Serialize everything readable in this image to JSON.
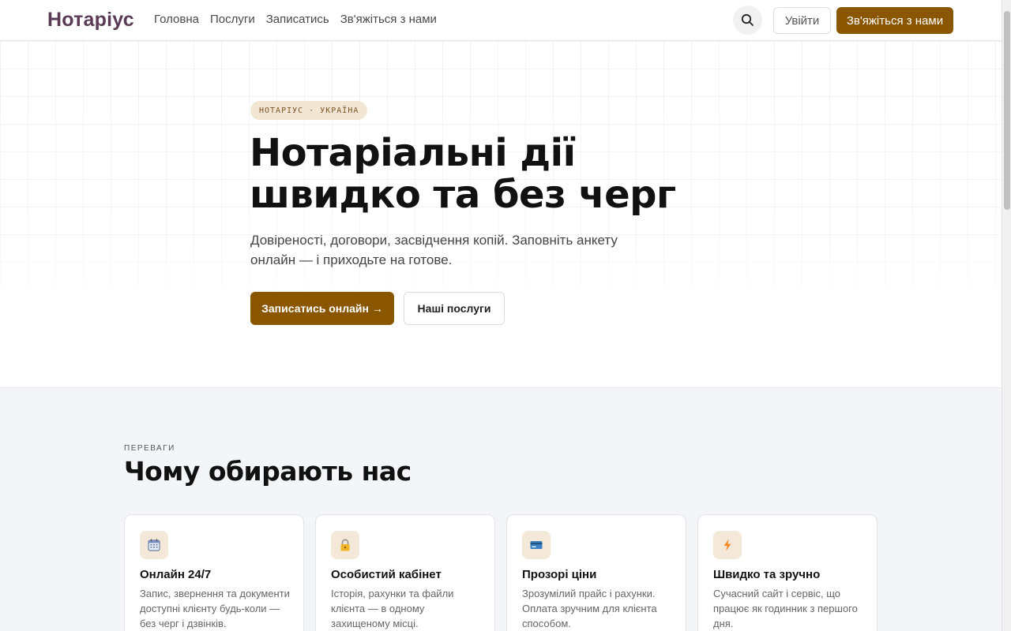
{
  "header": {
    "logo": "Нотаріус",
    "nav": [
      "Головна",
      "Послуги",
      "Записатись",
      "Зв'яжіться з нами"
    ],
    "search_icon": "search-icon",
    "login_label": "Увійти",
    "contact_label": "Зв'яжіться з нами"
  },
  "hero": {
    "badge": "НОТАРІУС · УКРАЇНА",
    "title": "Нотаріальні дії швидко та без черг",
    "subtitle": "Довіреності, договори, засвідчення копій. Заповніть анкету онлайн — і приходьте на готове.",
    "primary_button": "Записатись онлайн →",
    "secondary_button": "Наші послуги"
  },
  "advantages": {
    "eyebrow": "ПЕРЕВАГИ",
    "title": "Чому обирають нас",
    "cards": [
      {
        "icon": "calendar-icon",
        "title": "Онлайн 24/7",
        "text": "Запис, звернення та документи доступні клієнту будь-коли — без черг і дзвінків."
      },
      {
        "icon": "lock-icon",
        "title": "Особистий кабінет",
        "text": "Історія, рахунки та файли клієнта — в одному захищеному місці."
      },
      {
        "icon": "credit-card-icon",
        "title": "Прозорі ціни",
        "text": "Зрозумілий прайс і рахунки. Оплата зручним для клієнта способом."
      },
      {
        "icon": "lightning-icon",
        "title": "Швидко та зручно",
        "text": "Сучасний сайт і сервіс, що працює як годинник з першого дня."
      }
    ]
  },
  "colors": {
    "brand": "#8a5600",
    "logo": "#5a3a55",
    "badge_bg": "#f3e6d4",
    "section_bg": "#f4f5f8"
  }
}
